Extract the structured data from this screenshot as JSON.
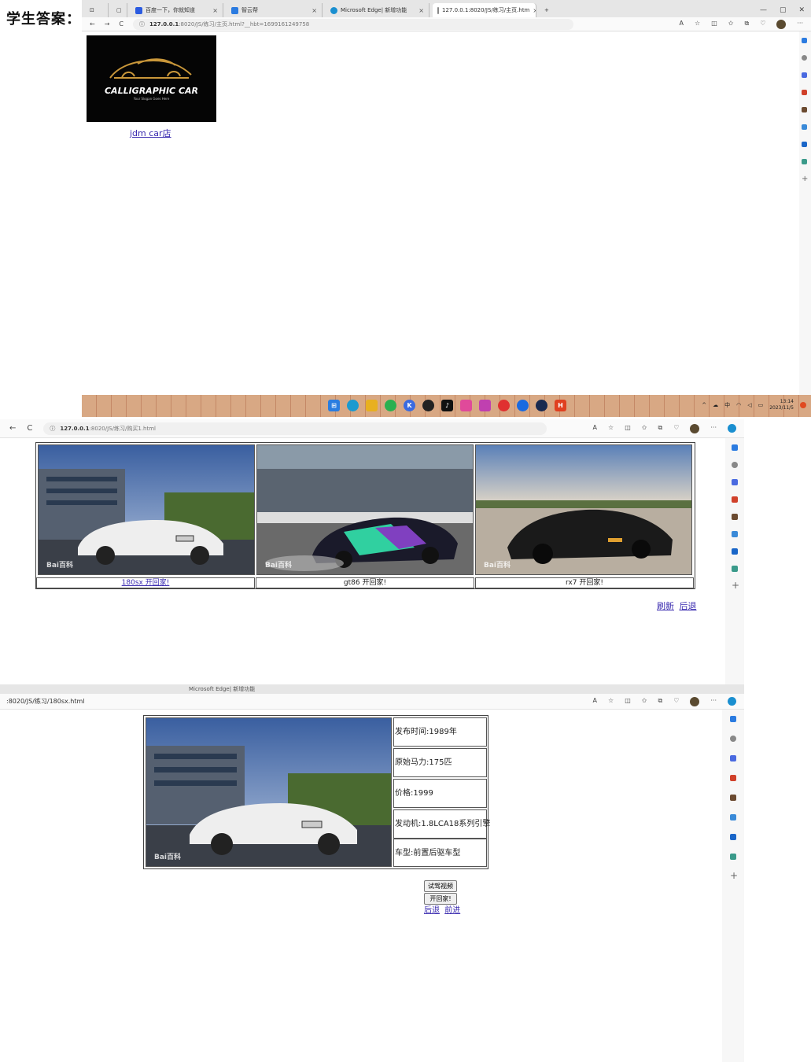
{
  "label": "学生答案：",
  "shot1": {
    "tabs": [
      {
        "title": "百度一下，你就知道",
        "color": "#2b5be0"
      },
      {
        "title": "智云帮",
        "color": "#2b7be0"
      },
      {
        "title": "Microsoft Edge| 新增功能",
        "color": "#1a8fd0"
      },
      {
        "title": "127.0.0.1:8020/JS/练习/主页.htm",
        "color": "#888888"
      }
    ],
    "new_tab": "+",
    "close": "×",
    "url_host": "127.0.0.1",
    "url_path": ":8020/JS/练习/主页.html?__hbt=1699161249758",
    "logo_brand": "CALLIGRAPHIC CAR",
    "logo_slogan": "Your Slogan Goes Here",
    "link_text": "jdm car店",
    "clock_time": "13:14",
    "clock_date": "2023/11/5",
    "tray_lang": "中"
  },
  "shot2": {
    "url_host": "127.0.0.1",
    "url_path": ":8020/JS/练习/购买1.html",
    "cars": [
      {
        "caption": "180sx 开回家!",
        "is_link": true,
        "watermark": "Bai百科"
      },
      {
        "caption": "gt86 开回家!",
        "is_link": false,
        "watermark": "Bai百科"
      },
      {
        "caption": "rx7 开回家!",
        "is_link": false,
        "watermark": "Bai百科"
      }
    ],
    "refresh_link": "刷新",
    "back_link": "后退"
  },
  "shot3": {
    "url_text": ":8020/JS/练习/180sx.html",
    "tab_fragment": "Microsoft Edge| 新增功能",
    "specs": [
      "发布时间:1989年",
      "原始马力:175匹",
      "价格:1999",
      "发动机:1.8LCA18系列引擎",
      "车型:前置后驱车型"
    ],
    "watermark": "Bai百科",
    "test_drive_button": "试驾视频",
    "drive_home_button": "开回家!",
    "back_link": "后退",
    "forward_link": "前进"
  }
}
